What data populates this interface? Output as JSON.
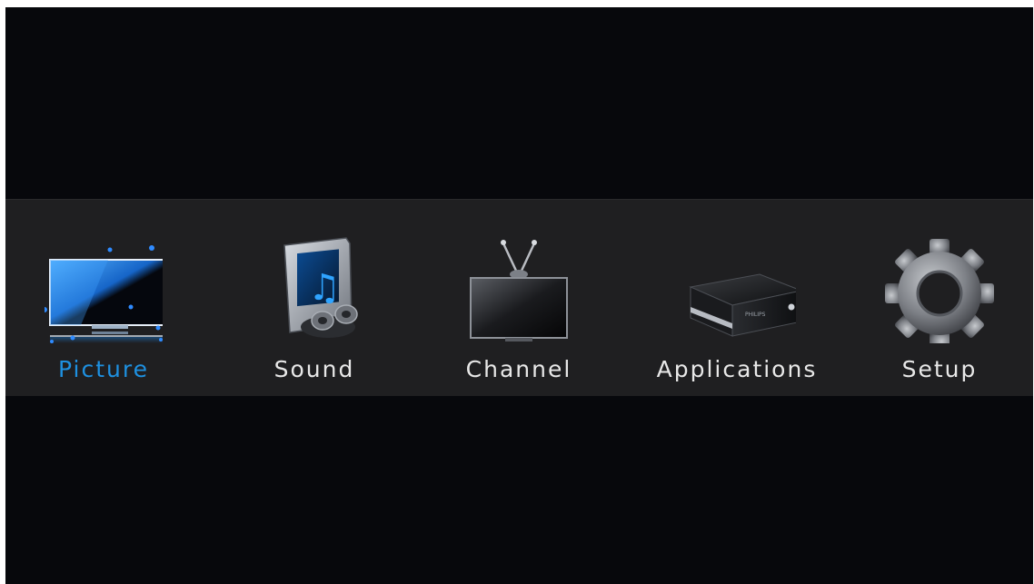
{
  "menu": {
    "selected_index": 0,
    "items": [
      {
        "label": "Picture",
        "icon": "picture-monitor-icon",
        "selected": true
      },
      {
        "label": "Sound",
        "icon": "sound-music-folder-icon",
        "selected": false
      },
      {
        "label": "Channel",
        "icon": "channel-tv-antenna-icon",
        "selected": false
      },
      {
        "label": "Applications",
        "icon": "applications-media-box-icon",
        "selected": false
      },
      {
        "label": "Setup",
        "icon": "setup-gear-icon",
        "selected": false
      }
    ]
  },
  "colors": {
    "background": "#07080c",
    "menu_bar": "#1f1f21",
    "label": "#e8e8e8",
    "selected_label": "#1e90e0",
    "accent_blue": "#1e7fd8"
  }
}
